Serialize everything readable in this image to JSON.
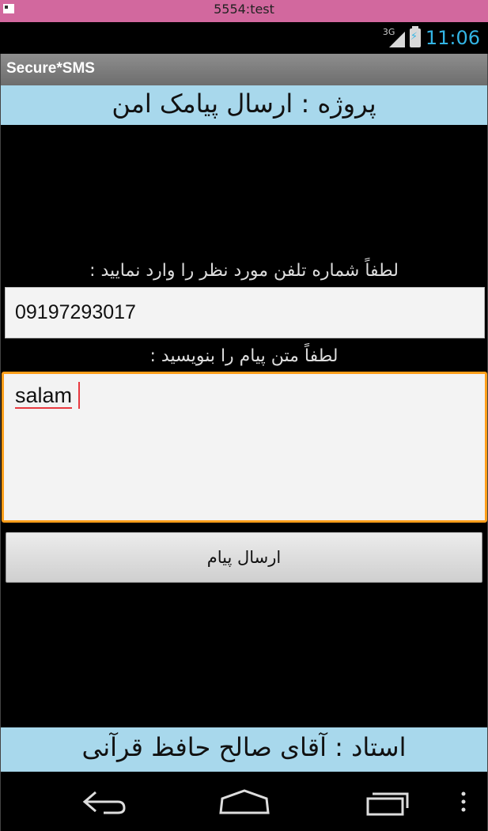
{
  "window": {
    "title": "5554:test"
  },
  "status_bar": {
    "network": "3G",
    "time": "11:06",
    "accent": "#33b5e5"
  },
  "action_bar": {
    "app_title": "Secure*SMS"
  },
  "header": {
    "title": "پروژه : ارسال پیامک امن"
  },
  "form": {
    "phone_label": "لطفاً شماره تلفن مورد نظر را وارد نمایید :",
    "phone_value": "09197293017",
    "message_label": "لطفاً متن پیام را بنویسید :",
    "message_value": "salam",
    "send_label": "ارسال پیام"
  },
  "footer": {
    "text": "استاد : آقای صالح حافظ قرآنی"
  },
  "navigation": {
    "icons": [
      "back-icon",
      "home-icon",
      "recents-icon",
      "menu-icon"
    ]
  },
  "colors": {
    "band": "#a8d8ec",
    "focus_border": "#ff9e1a",
    "titlebar": "#d2689e"
  }
}
